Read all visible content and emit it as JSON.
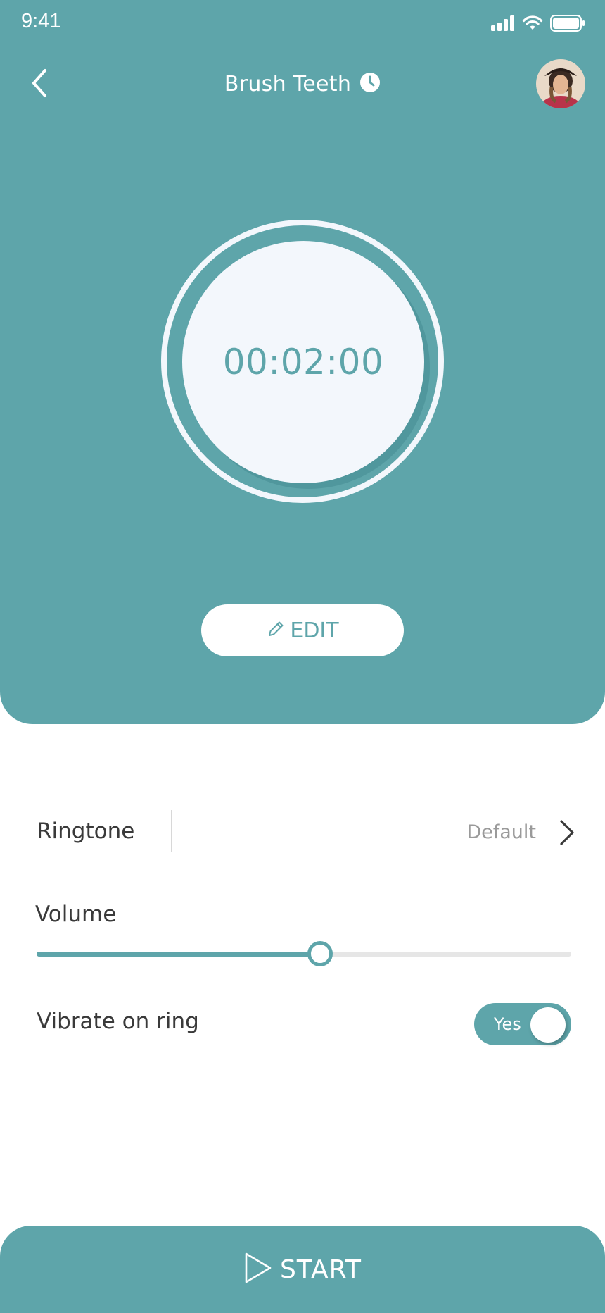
{
  "status_bar": {
    "time": "9:41"
  },
  "header": {
    "title": "Brush Teeth"
  },
  "timer": {
    "value": "00:02:00"
  },
  "edit_button": {
    "label": "EDIT"
  },
  "settings": {
    "ringtone": {
      "label": "Ringtone",
      "value": "Default"
    },
    "volume": {
      "label": "Volume",
      "level_percent": 53
    },
    "vibrate": {
      "label": "Vibrate on ring",
      "toggle_text": "Yes",
      "enabled": true
    }
  },
  "start_button": {
    "label": "START"
  },
  "colors": {
    "accent": "#5ea5aa",
    "surface": "#f3f7fc",
    "text": "#3a3a3a",
    "muted": "#9a9a9a"
  }
}
